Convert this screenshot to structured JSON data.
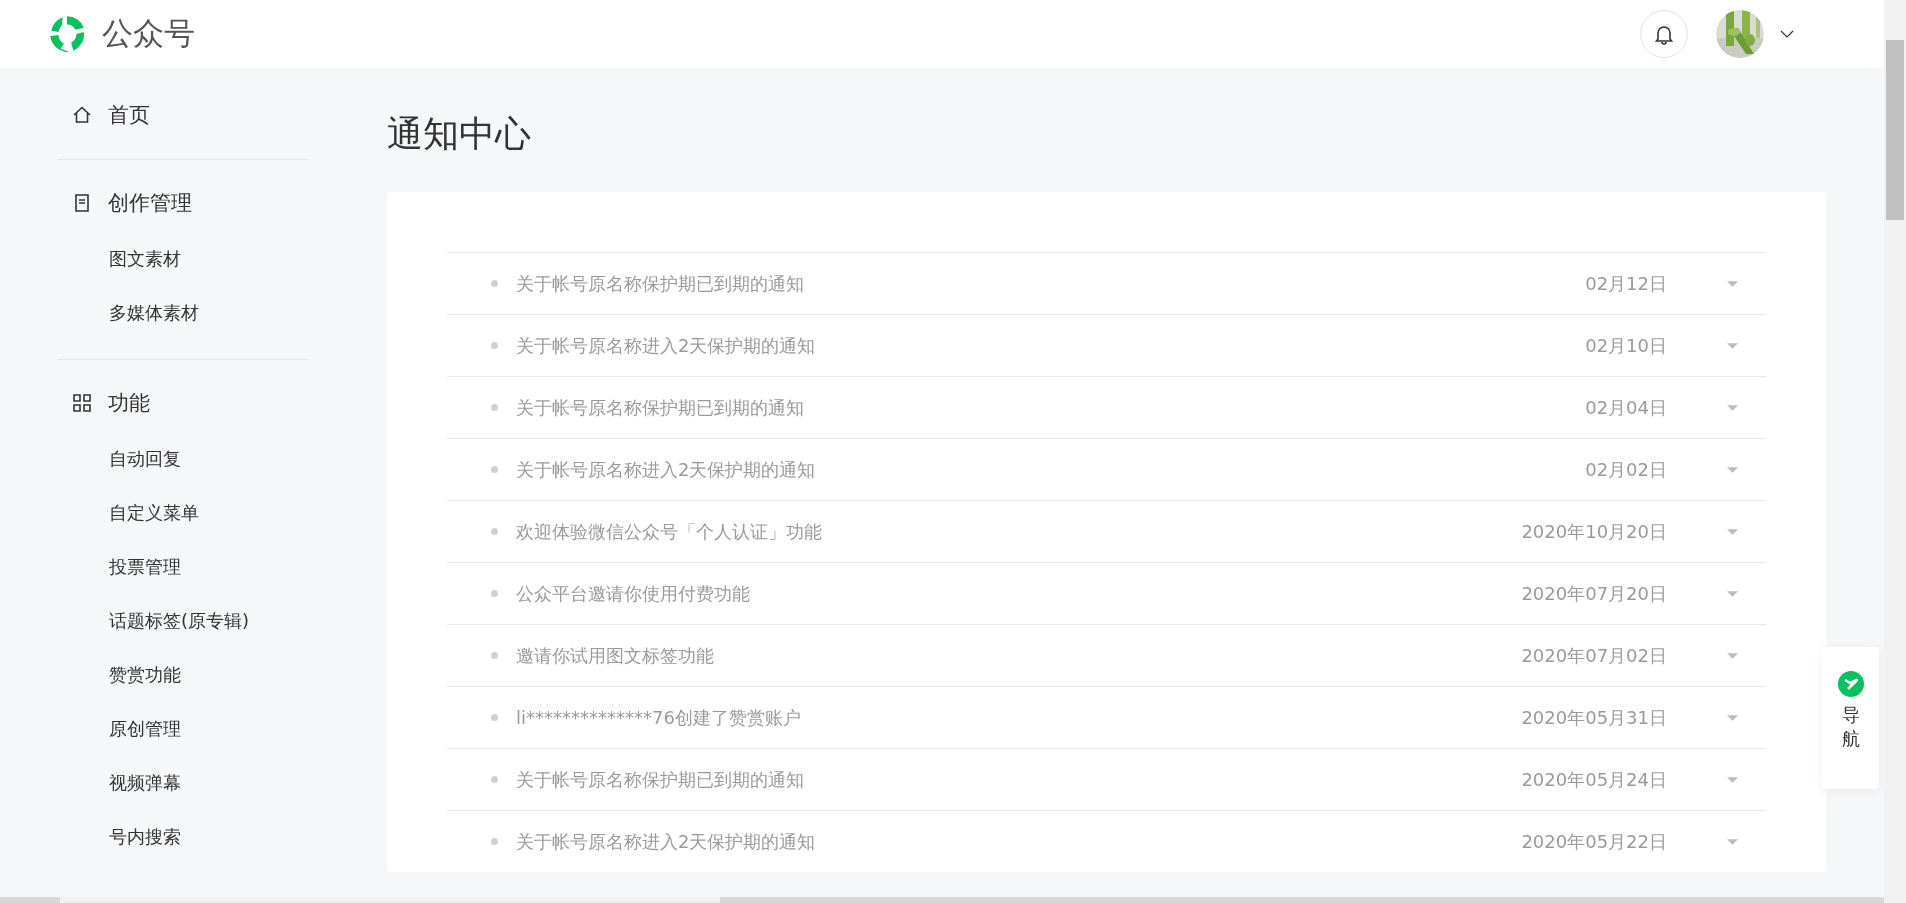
{
  "header": {
    "brand": "公众号"
  },
  "sidebar": {
    "sections": [
      {
        "title": "首页",
        "kind": "home"
      },
      {
        "title": "创作管理",
        "kind": "document",
        "items": [
          "图文素材",
          "多媒体素材"
        ]
      },
      {
        "title": "功能",
        "kind": "grid",
        "items": [
          "自动回复",
          "自定义菜单",
          "投票管理",
          "话题标签(原专辑)",
          "赞赏功能",
          "原创管理",
          "视频弹幕",
          "号内搜索"
        ]
      }
    ]
  },
  "page": {
    "title": "通知中心"
  },
  "notifications": [
    {
      "title": "关于帐号原名称保护期已到期的通知",
      "date": "02月12日"
    },
    {
      "title": "关于帐号原名称进入2天保护期的通知",
      "date": "02月10日"
    },
    {
      "title": "关于帐号原名称保护期已到期的通知",
      "date": "02月04日"
    },
    {
      "title": "关于帐号原名称进入2天保护期的通知",
      "date": "02月02日"
    },
    {
      "title": "欢迎体验微信公众号「个人认证」功能",
      "date": "2020年10月20日"
    },
    {
      "title": "公众平台邀请你使用付费功能",
      "date": "2020年07月20日"
    },
    {
      "title": "邀请你试用图文标签功能",
      "date": "2020年07月02日"
    },
    {
      "title": "li**************76创建了赞赏账户",
      "date": "2020年05月31日"
    },
    {
      "title": "关于帐号原名称保护期已到期的通知",
      "date": "2020年05月24日"
    },
    {
      "title": "关于帐号原名称进入2天保护期的通知",
      "date": "2020年05月22日"
    }
  ],
  "nav_widget": {
    "label": "导航"
  }
}
